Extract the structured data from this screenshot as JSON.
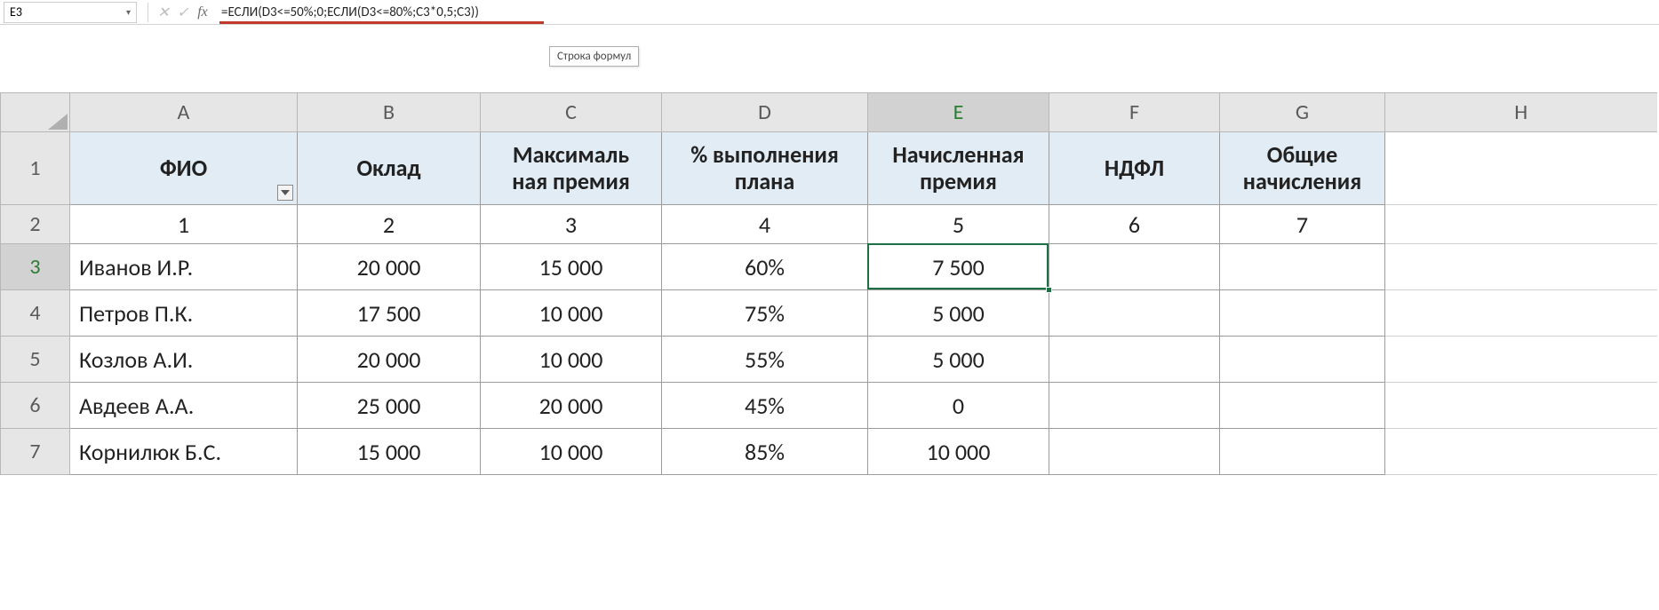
{
  "nameBox": "E3",
  "formula": "=ЕСЛИ(D3<=50%;0;ЕСЛИ(D3<=80%;C3*0,5;C3))",
  "tooltip": "Строка формул",
  "columns": [
    "A",
    "B",
    "C",
    "D",
    "E",
    "F",
    "G",
    "H"
  ],
  "selectedColumn": "E",
  "rowLabels": [
    "1",
    "2",
    "3",
    "4",
    "5",
    "6",
    "7"
  ],
  "selectedRow": "3",
  "headers": {
    "A": "ФИО",
    "B": "Оклад",
    "C": "Максималь\nная премия",
    "D": "% выполнения плана",
    "E": "Начисленная премия",
    "F": "НДФЛ",
    "G": "Общие начисления"
  },
  "indexRow": {
    "A": "1",
    "B": "2",
    "C": "3",
    "D": "4",
    "E": "5",
    "F": "6",
    "G": "7"
  },
  "rows": [
    {
      "A": "Иванов И.Р.",
      "B": "20 000",
      "C": "15 000",
      "D": "60%",
      "E": "7 500",
      "F": "",
      "G": ""
    },
    {
      "A": "Петров П.К.",
      "B": "17 500",
      "C": "10 000",
      "D": "75%",
      "E": "5 000",
      "F": "",
      "G": ""
    },
    {
      "A": "Козлов А.И.",
      "B": "20 000",
      "C": "10 000",
      "D": "55%",
      "E": "5 000",
      "F": "",
      "G": ""
    },
    {
      "A": "Авдеев А.А.",
      "B": "25 000",
      "C": "20 000",
      "D": "45%",
      "E": "0",
      "F": "",
      "G": ""
    },
    {
      "A": "Корнилюк Б.С.",
      "B": "15 000",
      "C": "10 000",
      "D": "85%",
      "E": "10 000",
      "F": "",
      "G": ""
    }
  ],
  "icons": {
    "cancel": "✕",
    "enter": "✓",
    "fx": "fx",
    "dd": "▾"
  }
}
